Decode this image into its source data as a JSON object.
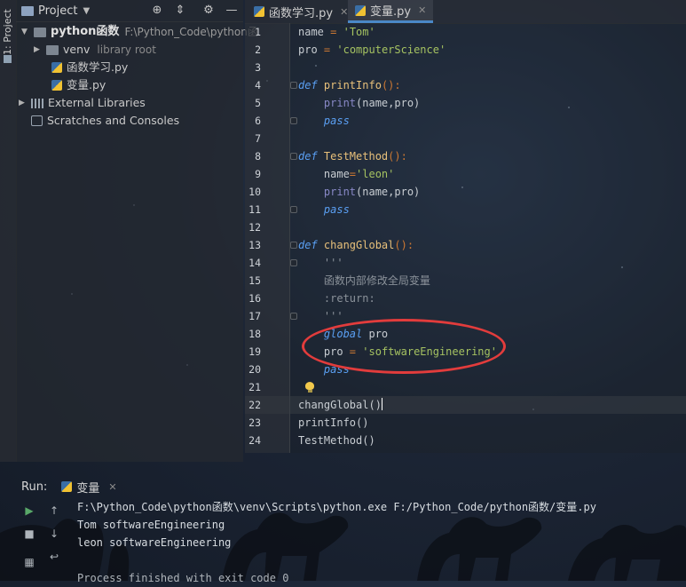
{
  "tool_strip": {
    "label": "1: Project"
  },
  "project_panel": {
    "title": "Project",
    "tree": [
      {
        "name": "python函数",
        "path": "F:\\Python_Code\\python函",
        "type": "root"
      },
      {
        "name": "venv",
        "note": "library root",
        "type": "folder"
      },
      {
        "name": "函数学习.py",
        "type": "file"
      },
      {
        "name": "变量.py",
        "type": "file"
      },
      {
        "name": "External Libraries",
        "type": "lib"
      },
      {
        "name": "Scratches and Consoles",
        "type": "scratch"
      }
    ]
  },
  "editor": {
    "tabs": [
      {
        "label": "函数学习.py",
        "active": false
      },
      {
        "label": "变量.py",
        "active": true
      }
    ],
    "line_numbers": [
      "1",
      "2",
      "3",
      "4",
      "5",
      "6",
      "7",
      "8",
      "9",
      "10",
      "11",
      "12",
      "13",
      "14",
      "15",
      "16",
      "17",
      "18",
      "19",
      "20",
      "21",
      "22",
      "23",
      "24"
    ],
    "code": {
      "l1_a": "name",
      "l1_b": " = ",
      "l1_c": "'Tom'",
      "l2_a": "pro",
      "l2_b": " = ",
      "l2_c": "'computerScience'",
      "l4_kw": "def",
      "l4_fn": " printInfo",
      "l4_p": "():",
      "l5_bi": "    print",
      "l5_rest": "(name,pro)",
      "l6": "    pass",
      "l8_kw": "def",
      "l8_fn": " TestMethod",
      "l8_p": "():",
      "l9_a": "    name",
      "l9_b": "=",
      "l9_c": "'leon'",
      "l10_bi": "    print",
      "l10_rest": "(name,pro)",
      "l11": "    pass",
      "l13_kw": "def",
      "l13_fn": " changGlobal",
      "l13_p": "():",
      "l14": "    '''",
      "l15": "    函数内部修改全局变量",
      "l16": "    :return:",
      "l17": "    '''",
      "l18_kw": "    global",
      "l18_rest": " pro",
      "l19_a": "    pro",
      "l19_b": " = ",
      "l19_c": "'softwareEngineering'",
      "l20": "    pass",
      "l22": "changGlobal()",
      "l23": "printInfo()",
      "l24": "TestMethod()"
    }
  },
  "run_panel": {
    "label": "Run:",
    "tab_label": "变量",
    "console": [
      "F:\\Python_Code\\python函数\\venv\\Scripts\\python.exe F:/Python_Code/python函数/变量.py",
      "Tom softwareEngineering",
      "leon softwareEngineering",
      "",
      "Process finished with exit code 0"
    ]
  },
  "colors": {
    "annotation": "#e23c3c",
    "keyword": "#cc7832",
    "string": "#a5c261",
    "accent_tab": "#4a88c7"
  }
}
